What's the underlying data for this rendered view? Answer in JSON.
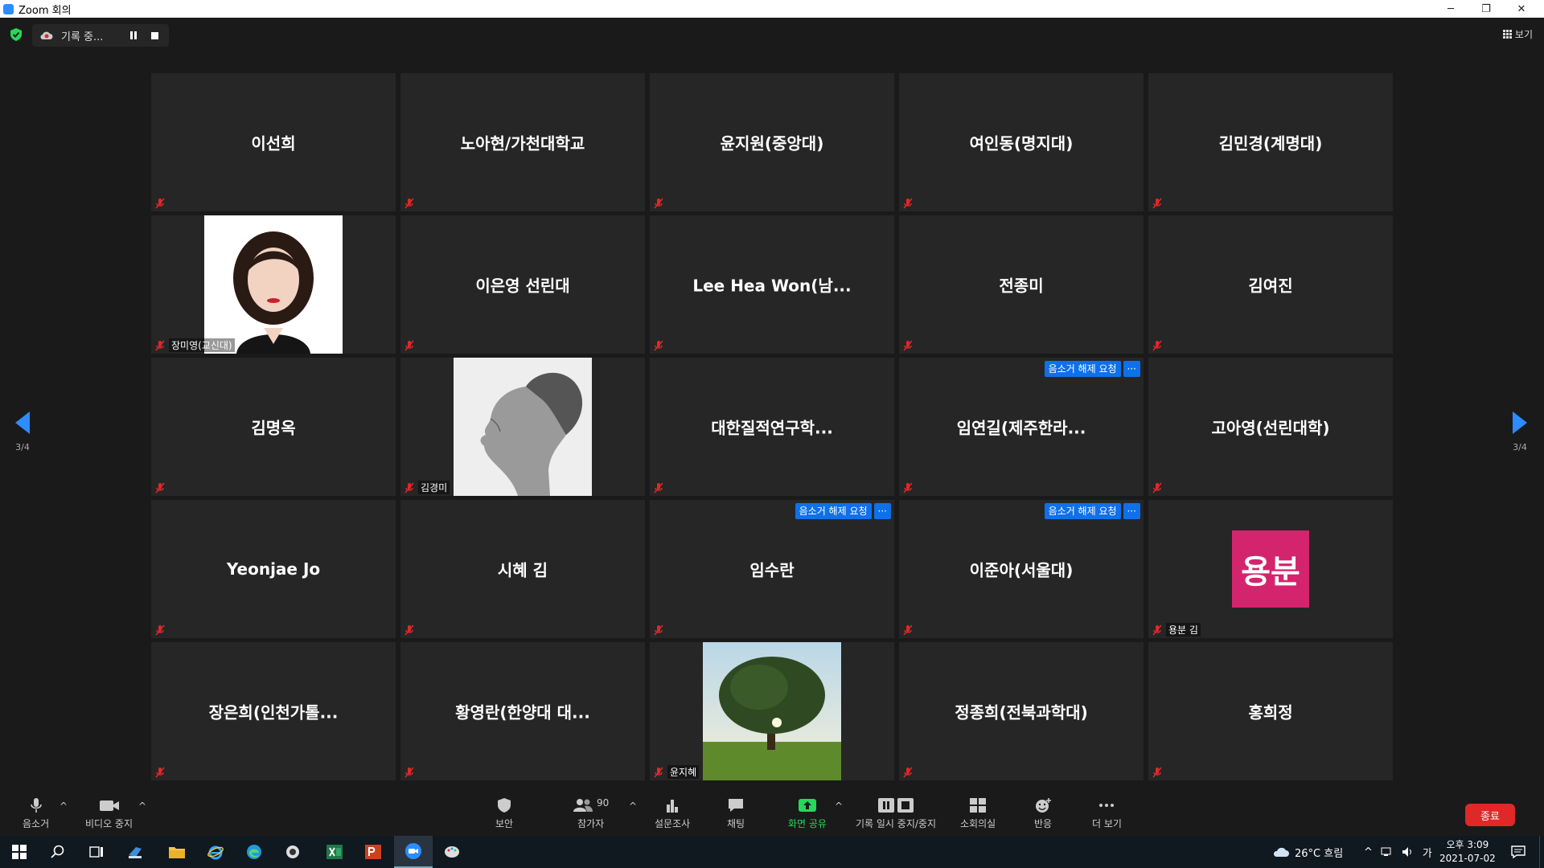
{
  "window": {
    "title": "Zoom 회의",
    "minimize": "─",
    "restore": "❐",
    "close": "✕"
  },
  "recording": {
    "label": "기록 중..."
  },
  "view_button": {
    "label": "보기"
  },
  "colors": {
    "accent": "#2d8cff",
    "end": "#e02828",
    "share_green": "#23d959",
    "mute_red": "#e02828",
    "request_blue": "#0e71eb",
    "avatar_pink": "#d4246d"
  },
  "tiles": [
    {
      "name": "이선희",
      "label": ""
    },
    {
      "name": "노아현/가천대학교",
      "label": ""
    },
    {
      "name": "윤지원(중앙대)",
      "label": ""
    },
    {
      "name": "여인동(명지대)",
      "label": ""
    },
    {
      "name": "김민경(계명대)",
      "label": ""
    },
    {
      "name": "",
      "label": "장미영(교신대)"
    },
    {
      "name": "이은영 선린대",
      "label": ""
    },
    {
      "name": "Lee Hea Won(남...",
      "label": ""
    },
    {
      "name": "전종미",
      "label": ""
    },
    {
      "name": "김여진",
      "label": ""
    },
    {
      "name": "김명옥",
      "label": ""
    },
    {
      "name": "",
      "label": "김경미"
    },
    {
      "name": "대한질적연구학...",
      "label": ""
    },
    {
      "name": "임연길(제주한라...",
      "label": ""
    },
    {
      "name": "고아영(선린대학)",
      "label": ""
    },
    {
      "name": "Yeonjae Jo",
      "label": ""
    },
    {
      "name": "시혜 김",
      "label": ""
    },
    {
      "name": "임수란",
      "label": ""
    },
    {
      "name": "이준아(서울대)",
      "label": ""
    },
    {
      "name": "",
      "label": "용분 김",
      "avatar_text": "용분"
    },
    {
      "name": "장은희(인천가톨...",
      "label": ""
    },
    {
      "name": "황영란(한양대 대...",
      "label": ""
    },
    {
      "name": "",
      "label": "윤지혜"
    },
    {
      "name": "정종희(전북과학대)",
      "label": ""
    },
    {
      "name": "홍희정",
      "label": ""
    }
  ],
  "unmute_request": {
    "label": "음소거 해제 요청",
    "more": "···"
  },
  "pagination": {
    "left": "3/4",
    "right": "3/4"
  },
  "toolbar": {
    "mute": "음소거",
    "video": "비디오 중지",
    "security": "보안",
    "participants": "참가자",
    "participants_count": "90",
    "polls": "설문조사",
    "chat": "채팅",
    "share": "화면 공유",
    "record": "기록 일시 중지/중지",
    "breakout": "소회의실",
    "reactions": "반응",
    "more": "더 보기",
    "end": "종료",
    "caret": "^"
  },
  "taskbar": {
    "weather": "26°C 흐림",
    "ime": "가",
    "time": "오후 3:09",
    "date": "2021-07-02"
  }
}
